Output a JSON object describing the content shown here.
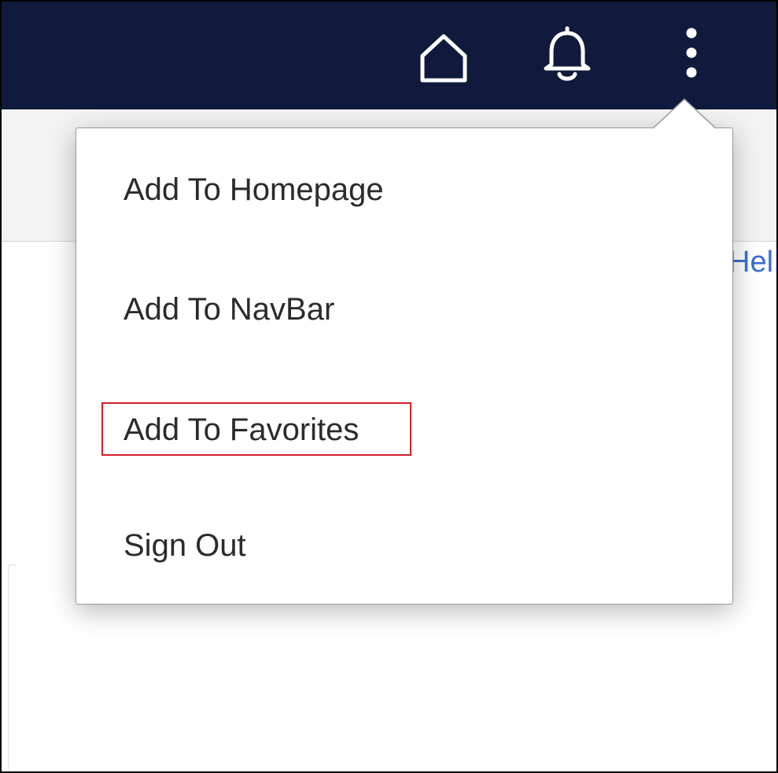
{
  "topbar": {
    "background": "#101a3c",
    "icons": [
      {
        "name": "home-icon"
      },
      {
        "name": "bell-icon"
      },
      {
        "name": "more-vertical-icon"
      }
    ]
  },
  "content": {
    "help_link_text": "Hel"
  },
  "menu": {
    "items": [
      {
        "label": "Add To Homepage"
      },
      {
        "label": "Add To NavBar"
      },
      {
        "label": "Add To Favorites",
        "highlighted": true
      },
      {
        "label": "Sign Out"
      }
    ],
    "highlight_color": "#d21e28"
  }
}
